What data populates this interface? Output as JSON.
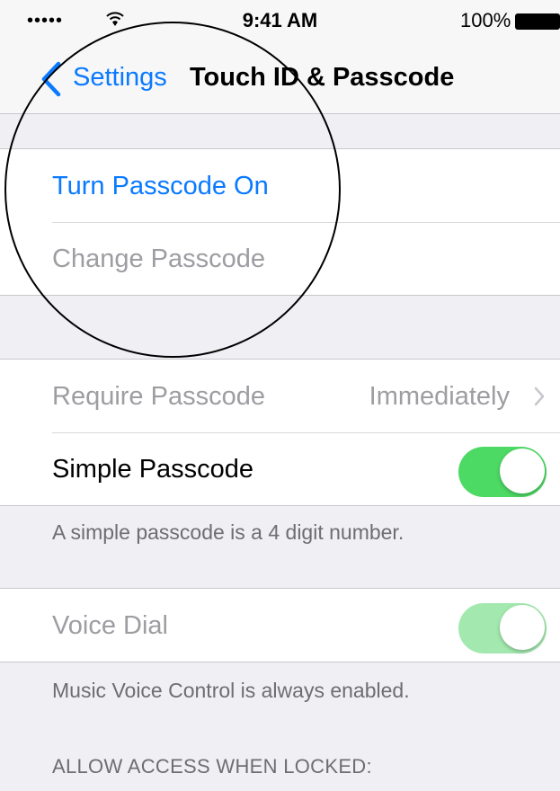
{
  "status_bar": {
    "signal": "•••••",
    "time": "9:41 AM",
    "battery": "100%"
  },
  "nav": {
    "back_label": "Settings",
    "title": "Touch ID & Passcode"
  },
  "passcode_group": {
    "turn_on": "Turn Passcode On",
    "change": "Change Passcode"
  },
  "settings_group": {
    "require_label": "Require Passcode",
    "require_value": "Immediately",
    "simple_label": "Simple Passcode",
    "simple_on": true
  },
  "simple_footer": "A simple passcode is a 4 digit number.",
  "voice_group": {
    "voice_label": "Voice Dial",
    "voice_on": true
  },
  "voice_footer": "Music Voice Control is always enabled.",
  "locked_header": "ALLOW ACCESS WHEN LOCKED:",
  "colors": {
    "accent": "#0a7aff",
    "toggle_on": "#4cd964",
    "background": "#efeff4"
  }
}
